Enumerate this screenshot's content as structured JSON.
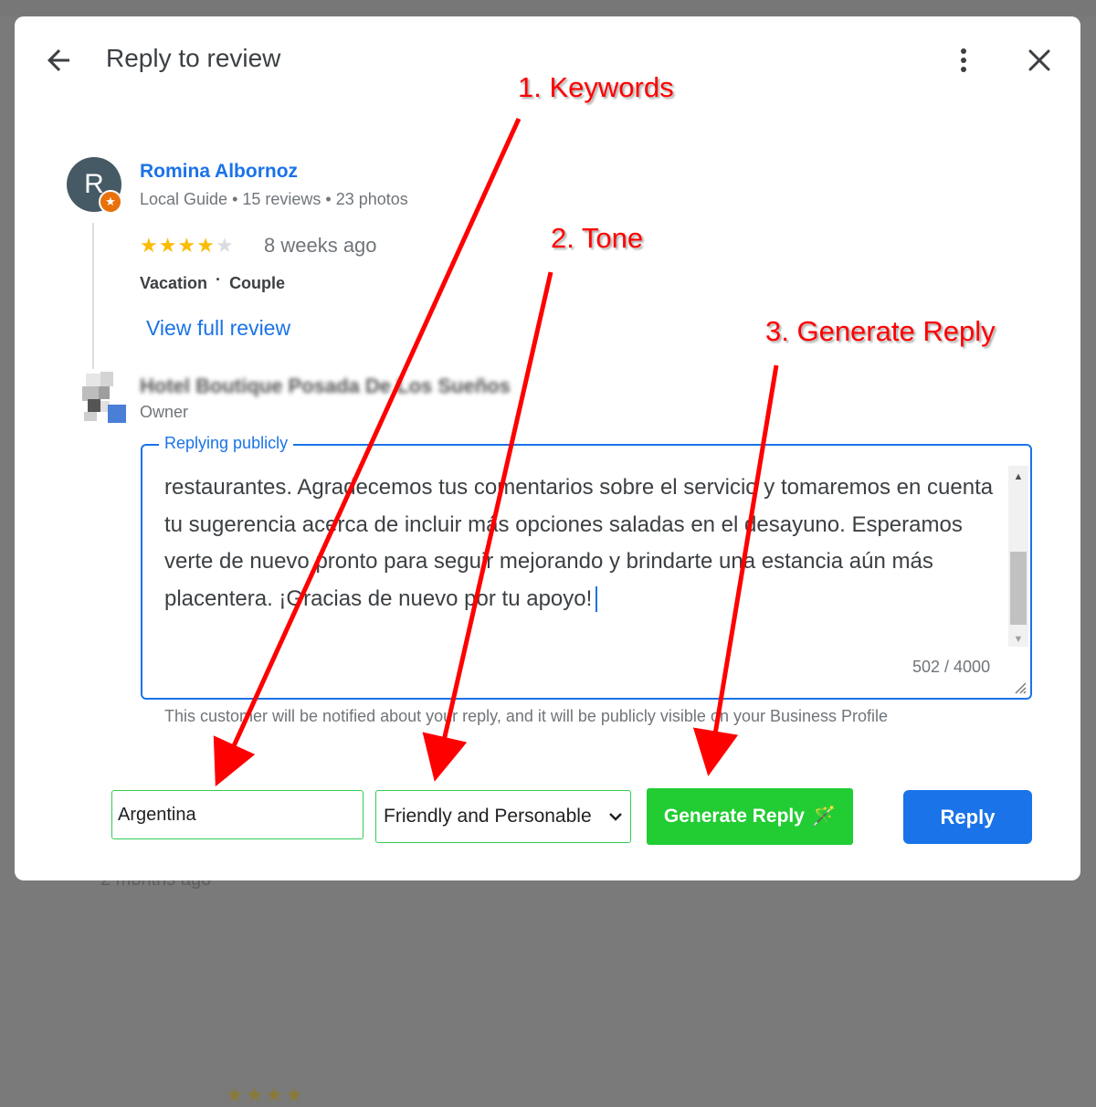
{
  "backdrop": {
    "behind_rating": "★★★★",
    "behind_date": "2 months ago"
  },
  "dialog": {
    "title": "Reply to review",
    "back_icon": "arrow-back-icon",
    "more_icon": "more-vert-icon",
    "close_icon": "close-icon"
  },
  "review": {
    "avatar_letter": "R",
    "reviewer_name": "Romina Albornoz",
    "reviewer_meta": "Local Guide • 15 reviews • 23 photos",
    "rating": 4,
    "rating_max": 5,
    "date": "8 weeks ago",
    "trip_type": "Vacation",
    "travel_group": "Couple",
    "tag_separator": "·",
    "view_full_label": "View full review"
  },
  "owner": {
    "name": "Hotel Boutique Posada De Los Sueños",
    "role": "Owner"
  },
  "reply": {
    "legend": "Replying publicly",
    "text": "restaurantes. Agradecemos tus comentarios sobre el servicio y tomaremos en cuenta tu sugerencia acerca de incluir más opciones saladas en el desayuno. Esperamos verte de nuevo pronto para seguir mejorando y brindarte una estancia aún más placentera. ¡Gracias de nuevo por tu apoyo!",
    "char_count": "502 / 4000",
    "notice": "This customer will be notified about your reply, and it will be publicly visible on your Business Profile"
  },
  "controls": {
    "keywords_value": "Argentina",
    "tone_selected": "Friendly and Personable",
    "generate_label": "Generate Reply",
    "generate_icon": "🪄",
    "reply_label": "Reply",
    "green": "#22cc33",
    "blue": "#1a73e8"
  },
  "annotations": {
    "keywords": "1. Keywords",
    "tone": "2. Tone",
    "generate": "3. Generate Reply",
    "color": "#ff0000"
  }
}
